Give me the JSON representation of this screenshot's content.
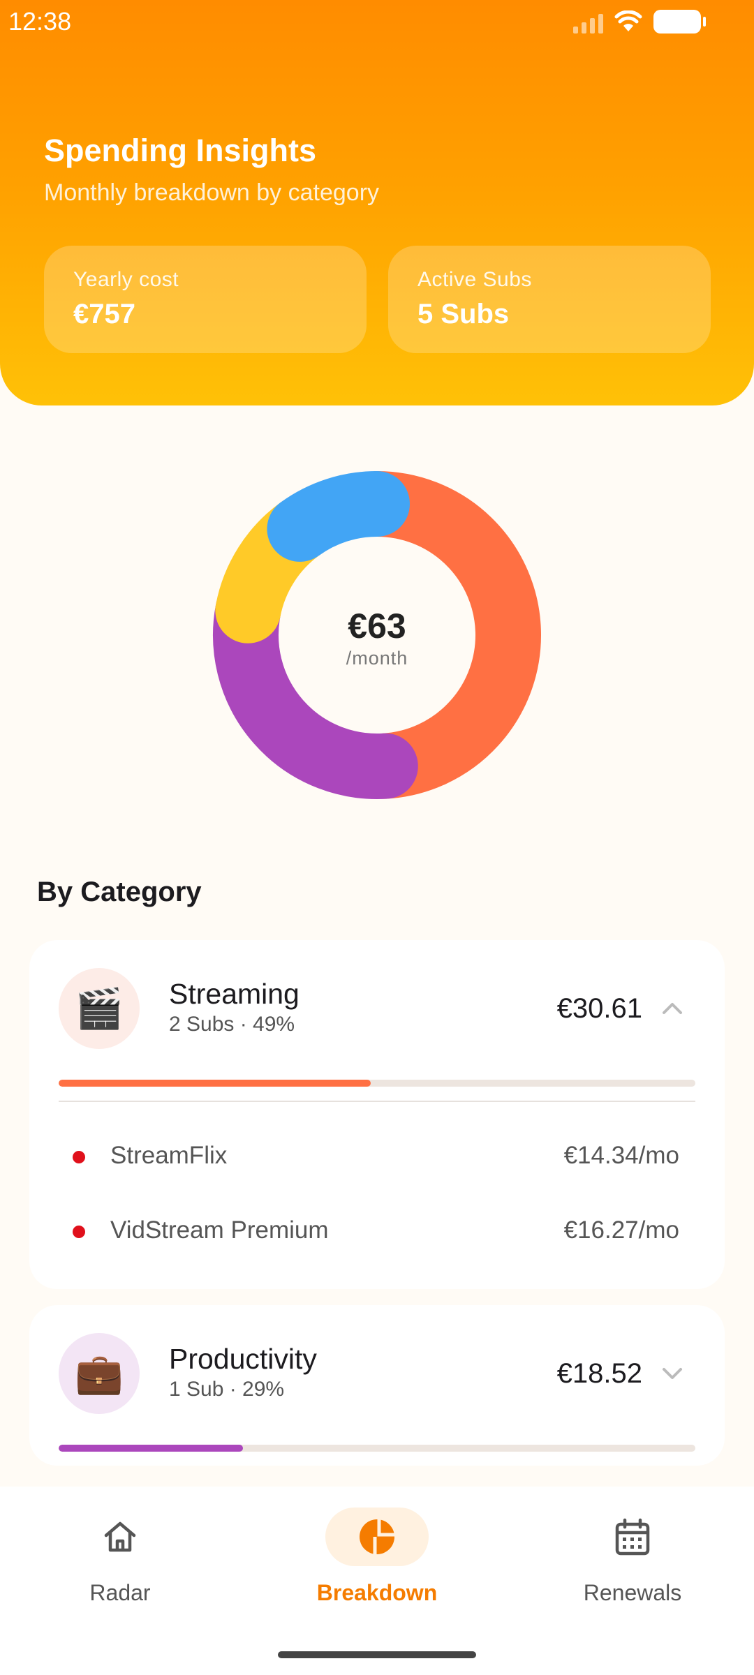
{
  "status_bar": {
    "time": "12:38"
  },
  "header": {
    "title": "Spending Insights",
    "subtitle": "Monthly breakdown by category",
    "stats": [
      {
        "label": "Yearly cost",
        "value": "€757"
      },
      {
        "label": "Active Subs",
        "value": "5 Subs"
      }
    ]
  },
  "donut": {
    "center_value": "€63",
    "center_sub": "/month",
    "segments": [
      {
        "name": "Streaming",
        "percent": 49,
        "color": "#FF7043"
      },
      {
        "name": "Productivity",
        "percent": 29,
        "color": "#AB47BC"
      },
      {
        "name": "Other (yellow)",
        "percent": 12,
        "color": "#FFCA28"
      },
      {
        "name": "Other (blue)",
        "percent": 10,
        "color": "#42A5F5"
      }
    ]
  },
  "section_title": "By Category",
  "categories": [
    {
      "name": "Streaming",
      "meta": "2 Subs · 49%",
      "amount": "€30.61",
      "percent": 49,
      "color": "#FF7043",
      "icon_bg": "#FDECE7",
      "icon": "clapperboard-icon",
      "icon_glyph": "🎬",
      "expanded": true,
      "subs": [
        {
          "name": "StreamFlix",
          "price": "€14.34/mo"
        },
        {
          "name": "VidStream Premium",
          "price": "€16.27/mo"
        }
      ]
    },
    {
      "name": "Productivity",
      "meta": "1 Sub · 29%",
      "amount": "€18.52",
      "percent": 29,
      "color": "#AB47BC",
      "icon_bg": "#F3E5F5",
      "icon": "briefcase-icon",
      "icon_glyph": "💼",
      "expanded": false
    }
  ],
  "nav": {
    "items": [
      {
        "label": "Radar",
        "icon": "home-icon"
      },
      {
        "label": "Breakdown",
        "icon": "pie-chart-icon",
        "active": true
      },
      {
        "label": "Renewals",
        "icon": "calendar-icon"
      }
    ]
  }
}
